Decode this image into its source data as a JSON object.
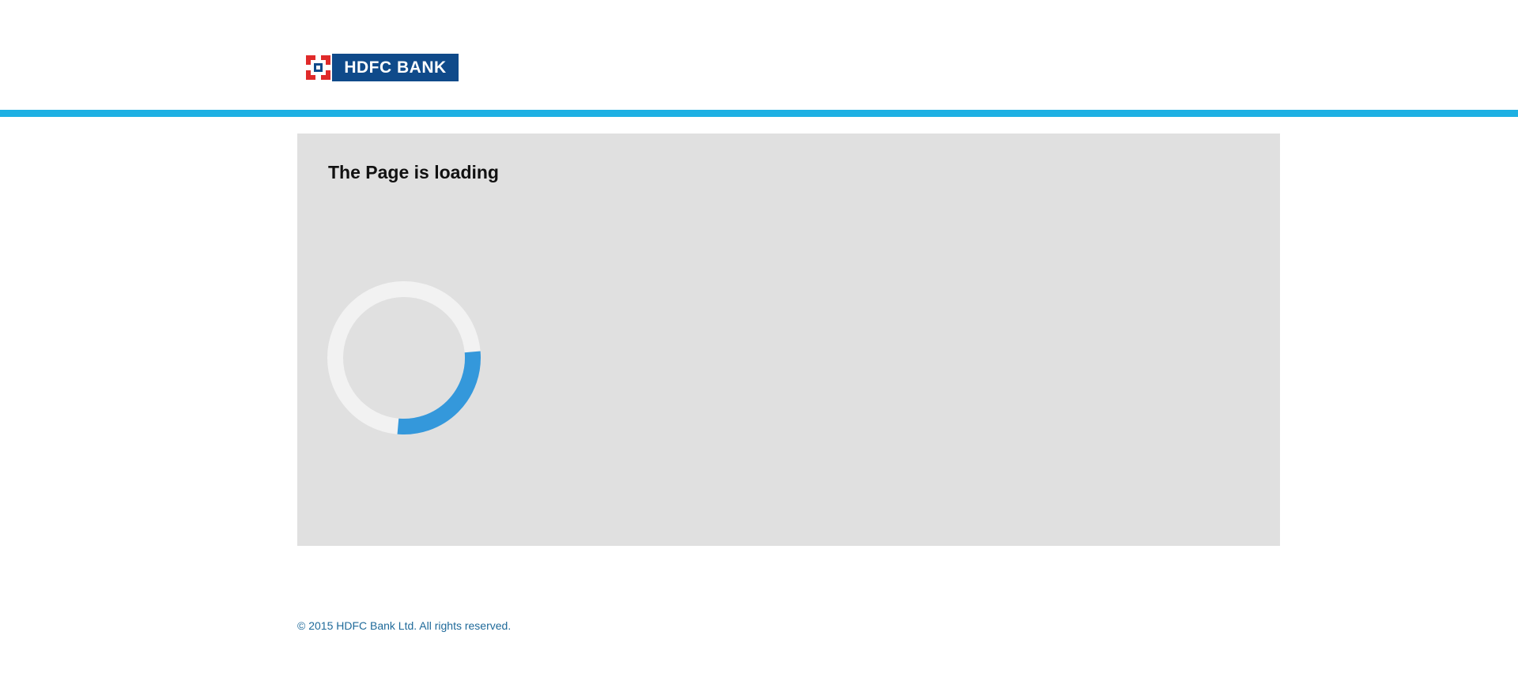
{
  "header": {
    "logo": {
      "text": "HDFC BANK",
      "mark_icon": "hdfc-logo-mark-icon"
    },
    "accent_color": "#1eb0e3"
  },
  "main": {
    "title": "The Page is loading",
    "spinner": {
      "icon": "loading-spinner-icon",
      "track_color": "#f2f2f2",
      "arc_color": "#3498db",
      "progress": 0.2
    }
  },
  "footer": {
    "copyright": "© 2015 HDFC Bank Ltd. All rights reserved.",
    "text_color": "#1f6a9a"
  },
  "colors": {
    "brand_blue": "#0f4a8a",
    "brand_red": "#e02a2a",
    "panel_bg": "#e0e0e0"
  }
}
